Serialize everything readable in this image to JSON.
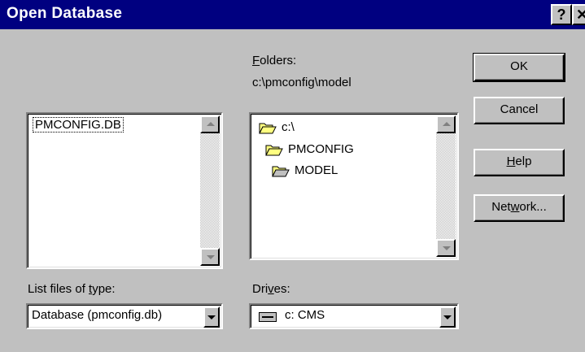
{
  "window": {
    "title": "Open Database",
    "help_glyph": "?",
    "close_glyph": "✕"
  },
  "folders": {
    "label_accel": "F",
    "label_rest": "olders:",
    "current_path": "c:\\pmconfig\\model",
    "tree": [
      {
        "name": "c:\\",
        "icon": "open-folder-icon"
      },
      {
        "name": "PMCONFIG",
        "icon": "open-folder-icon"
      },
      {
        "name": "MODEL",
        "icon": "open-folder-icon"
      }
    ]
  },
  "files": {
    "items": [
      "PMCONFIG.DB"
    ],
    "type_label_pre": "List files of ",
    "type_label_accel": "t",
    "type_label_post": "ype:",
    "type_value": "Database (pmconfig.db)"
  },
  "drives": {
    "label_pre": "Dri",
    "label_accel": "v",
    "label_post": "es:",
    "value": "c: CMS",
    "icon": "drive-icon"
  },
  "buttons": {
    "ok": "OK",
    "cancel": "Cancel",
    "help_accel": "H",
    "help_rest": "elp",
    "network_pre": "Net",
    "network_accel": "w",
    "network_post": "ork..."
  },
  "colors": {
    "title_bar": "#000080",
    "face": "#c0c0c0",
    "folder_fill": "#ffff80"
  }
}
